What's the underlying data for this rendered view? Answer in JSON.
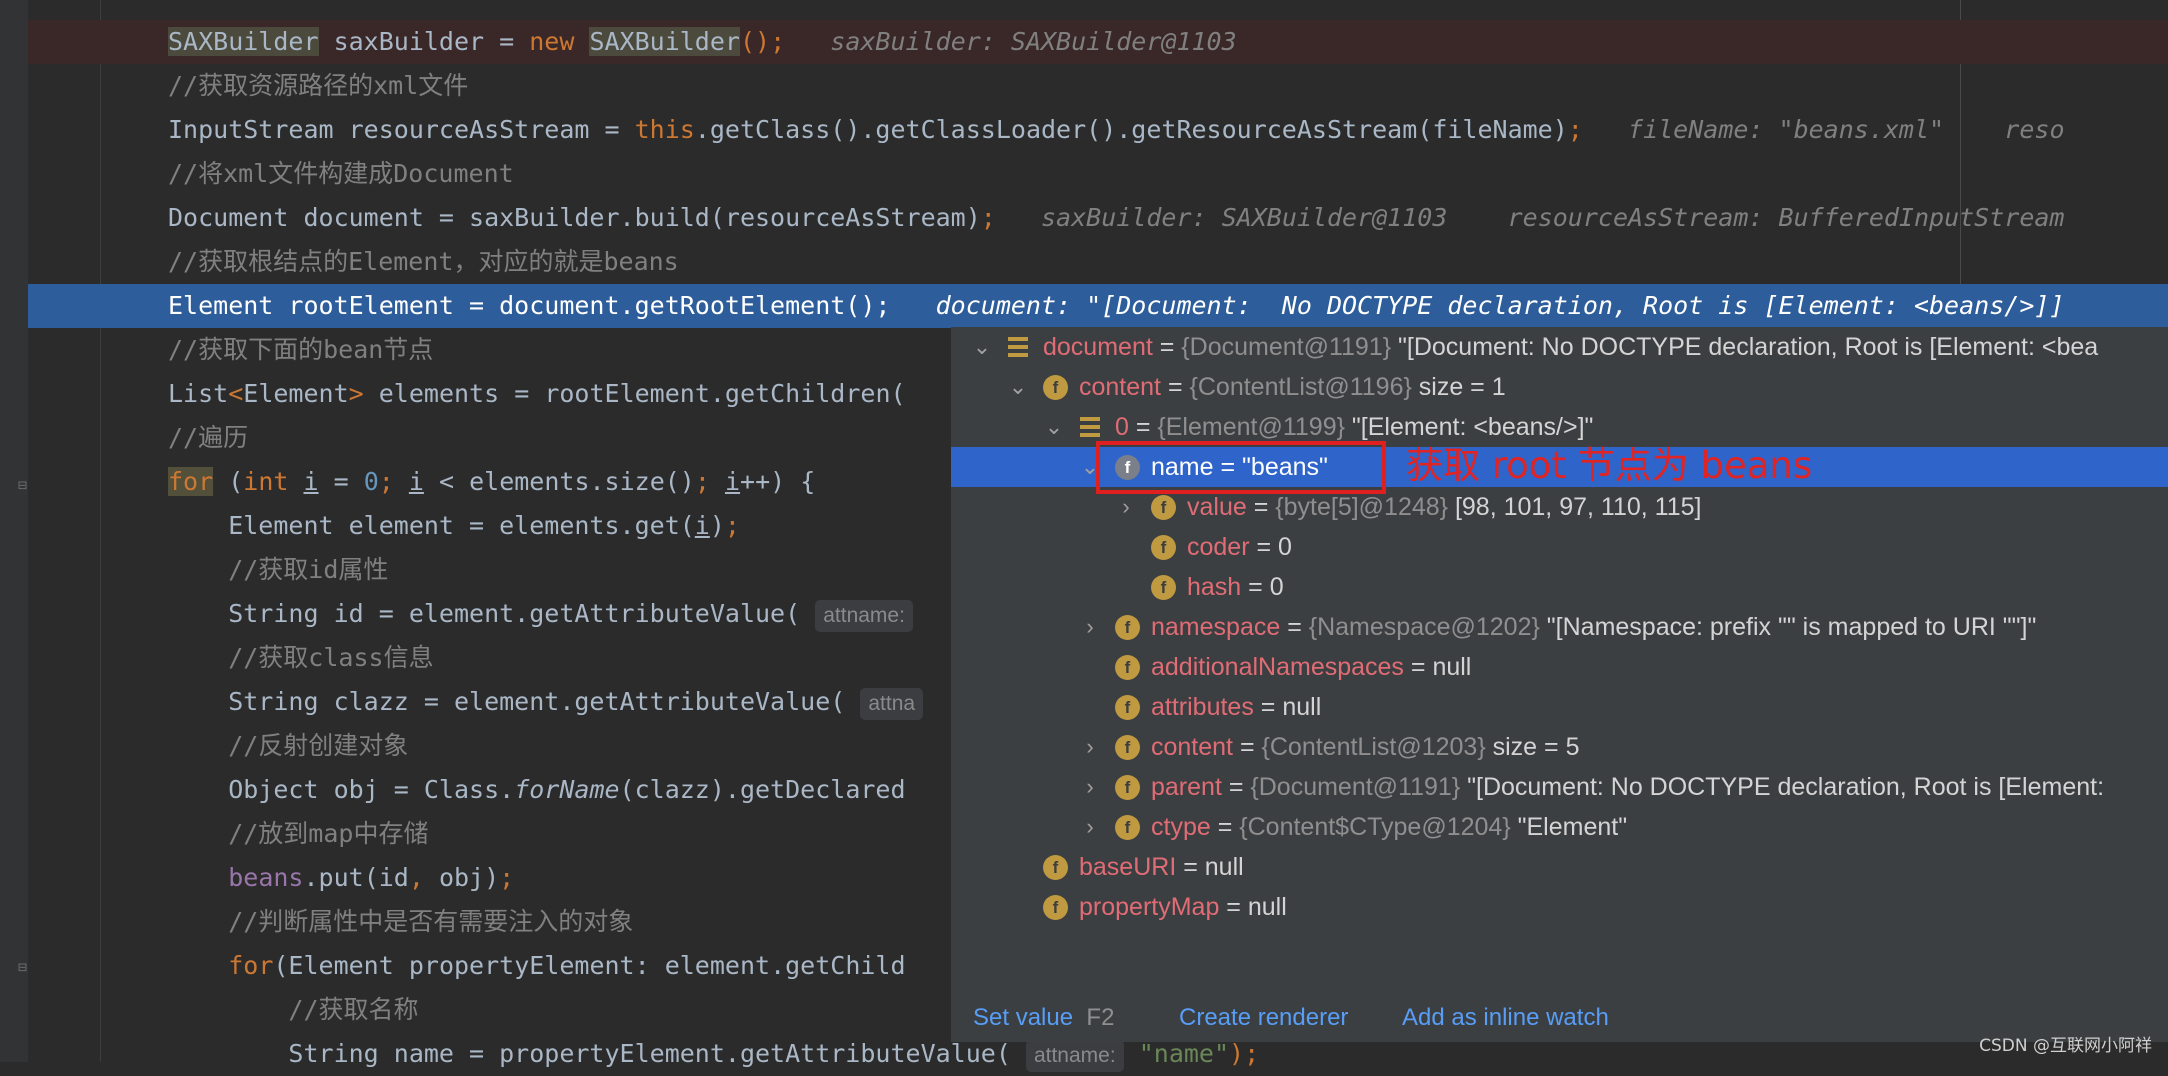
{
  "code_lines": [
    {
      "parts": [
        {
          "t": "SAXBuilder",
          "c": "cls-hl"
        },
        {
          "t": " saxBuilder = "
        },
        {
          "t": "new",
          "c": "kw"
        },
        {
          "t": " "
        },
        {
          "t": "SAXBuilder",
          "c": "cls-hl"
        },
        {
          "t": "();",
          "c": "kw"
        },
        {
          "t": "   saxBuilder: SAXBuilder@1103",
          "c": "hint"
        }
      ],
      "cls": "err"
    },
    {
      "parts": [
        {
          "t": "//获取资源路径的xml文件",
          "c": "cm"
        }
      ]
    },
    {
      "parts": [
        {
          "t": "InputStream resourceAsStream = "
        },
        {
          "t": "this",
          "c": "kw"
        },
        {
          "t": ".getClass().getClassLoader().getResourceAsStream(fileName)"
        },
        {
          "t": ";",
          "c": "kw"
        },
        {
          "t": "   fileName: \"beans.xml\"    reso",
          "c": "hint"
        }
      ]
    },
    {
      "parts": [
        {
          "t": "//将xml文件构建成Document",
          "c": "cm"
        }
      ]
    },
    {
      "parts": [
        {
          "t": "Document document = saxBuilder.build(resourceAsStream)"
        },
        {
          "t": ";",
          "c": "kw"
        },
        {
          "t": "   saxBuilder: SAXBuilder@1103    resourceAsStream: BufferedInputStream",
          "c": "hint"
        }
      ]
    },
    {
      "parts": [
        {
          "t": "//获取根结点的Element，对应的就是beans",
          "c": "cm"
        }
      ]
    },
    {
      "parts": [
        {
          "t": "Element rootElement = document.getRootElement();"
        },
        {
          "t": "   document: \"[Document:  No DOCTYPE declaration, Root is [Element: <beans/>]]",
          "c": "hint"
        }
      ],
      "cls": "sel"
    },
    {
      "parts": [
        {
          "t": "//获取下面的bean节点",
          "c": "cm"
        }
      ]
    },
    {
      "parts": [
        {
          "t": "List"
        },
        {
          "t": "<",
          "c": "kw"
        },
        {
          "t": "Element"
        },
        {
          "t": ">",
          "c": "kw"
        },
        {
          "t": " elements = rootElement.getChildren("
        }
      ]
    },
    {
      "parts": [
        {
          "t": "//遍历",
          "c": "cm"
        }
      ]
    },
    {
      "parts": [
        {
          "t": "for",
          "c": "kw kw-hl"
        },
        {
          "t": " ("
        },
        {
          "t": "int",
          "c": "kw"
        },
        {
          "t": " "
        },
        {
          "t": "i",
          "c": "under"
        },
        {
          "t": " = "
        },
        {
          "t": "0",
          "c": "num"
        },
        {
          "t": "; ",
          "c": "kw"
        },
        {
          "t": "i",
          "c": "under"
        },
        {
          "t": " < elements.size()"
        },
        {
          "t": "; ",
          "c": "kw"
        },
        {
          "t": "i",
          "c": "under"
        },
        {
          "t": "++) {"
        }
      ]
    },
    {
      "parts": [
        {
          "t": "    Element element = elements.get("
        },
        {
          "t": "i",
          "c": "under"
        },
        {
          "t": ")"
        },
        {
          "t": ";",
          "c": "kw"
        }
      ]
    },
    {
      "parts": [
        {
          "t": "    //获取id属性",
          "c": "cm"
        }
      ]
    },
    {
      "parts": [
        {
          "t": "    String id = element.getAttributeValue( "
        },
        {
          "t": "attname:",
          "c": "param"
        }
      ]
    },
    {
      "parts": [
        {
          "t": "    //获取class信息",
          "c": "cm"
        }
      ]
    },
    {
      "parts": [
        {
          "t": "    String clazz = element.getAttributeValue( "
        },
        {
          "t": "attna",
          "c": "param"
        }
      ]
    },
    {
      "parts": [
        {
          "t": "    //反射创建对象",
          "c": "cm"
        }
      ]
    },
    {
      "parts": [
        {
          "t": "    Object obj = Class."
        },
        {
          "t": "forName",
          "c": "ital"
        },
        {
          "t": "(clazz).getDeclared"
        }
      ]
    },
    {
      "parts": [
        {
          "t": "    //放到map中存储",
          "c": "cm"
        }
      ]
    },
    {
      "parts": [
        {
          "t": "    "
        },
        {
          "t": "beans",
          "c": "fld"
        },
        {
          "t": ".put(id"
        },
        {
          "t": ", ",
          "c": "kw"
        },
        {
          "t": "obj)"
        },
        {
          "t": ";",
          "c": "kw"
        }
      ]
    },
    {
      "parts": [
        {
          "t": "    //判断属性中是否有需要注入的对象",
          "c": "cm"
        }
      ]
    },
    {
      "parts": [
        {
          "t": "    "
        },
        {
          "t": "for",
          "c": "kw"
        },
        {
          "t": "(Element propertyElement: element.getChild"
        }
      ]
    },
    {
      "parts": [
        {
          "t": "        //获取名称",
          "c": "cm"
        }
      ]
    },
    {
      "parts": [
        {
          "t": "        String name = propertyElement.getAttributeValue( "
        },
        {
          "t": "attname:",
          "c": "param"
        },
        {
          "t": " "
        },
        {
          "t": "\"name\"",
          "c": "str"
        },
        {
          "t": ");",
          "c": "kw"
        }
      ]
    }
  ],
  "debug_tree": [
    {
      "toggle": "open",
      "icon": "arr",
      "name": "document",
      "type": "{Document@1191}",
      "value": "\"[Document:  No DOCTYPE declaration, Root is [Element: <bea"
    },
    {
      "toggle": "open",
      "icon": "f",
      "name": "content",
      "type": "{ContentList@1196}",
      "value": " size = 1"
    },
    {
      "toggle": "open",
      "icon": "arr",
      "name": "0",
      "type": "{Element@1199}",
      "value": "\"[Element: <beans/>]\""
    },
    {
      "toggle": "open",
      "icon": "f",
      "name": "name",
      "type": "",
      "value": "\"beans\"",
      "selected": true
    },
    {
      "toggle": "closed",
      "icon": "f",
      "name": "value",
      "type": "{byte[5]@1248}",
      "value": "[98, 101, 97, 110, 115]"
    },
    {
      "toggle": "",
      "icon": "f",
      "name": "coder",
      "type": "",
      "value": "0"
    },
    {
      "toggle": "",
      "icon": "f",
      "name": "hash",
      "type": "",
      "value": "0"
    },
    {
      "toggle": "closed",
      "icon": "f",
      "name": "namespace",
      "type": "{Namespace@1202}",
      "value": "\"[Namespace: prefix \"\" is mapped to URI \"\"]\""
    },
    {
      "toggle": "",
      "icon": "f",
      "name": "additionalNamespaces",
      "type": "",
      "value": "null"
    },
    {
      "toggle": "",
      "icon": "f",
      "name": "attributes",
      "type": "",
      "value": "null"
    },
    {
      "toggle": "closed",
      "icon": "f",
      "name": "content",
      "type": "{ContentList@1203}",
      "value": " size = 5"
    },
    {
      "toggle": "closed",
      "icon": "f",
      "name": "parent",
      "type": "{Document@1191}",
      "value": "\"[Document:  No DOCTYPE declaration, Root is [Element:"
    },
    {
      "toggle": "closed",
      "icon": "f",
      "name": "ctype",
      "type": "{Content$CType@1204}",
      "value": "\"Element\""
    },
    {
      "toggle": "",
      "icon": "f",
      "name": "baseURI",
      "type": "",
      "value": "null"
    },
    {
      "toggle": "",
      "icon": "f",
      "name": "propertyMap",
      "type": "",
      "value": "null"
    }
  ],
  "bottom_bar": {
    "set_value": "Set value",
    "set_value_key": "F2",
    "create_renderer": "Create renderer",
    "add_inline_watch": "Add as inline watch"
  },
  "annotation": "获取 root 节点为 beans",
  "watermark": "CSDN @互联网小阿祥",
  "icons": {
    "field": "f",
    "toggle_open": "⌄",
    "toggle_closed": "›"
  },
  "colors": {
    "accent": "#2f65ca",
    "selection": "#2d5d9a",
    "error_line": "#3a2727",
    "annotation": "#e02020"
  }
}
